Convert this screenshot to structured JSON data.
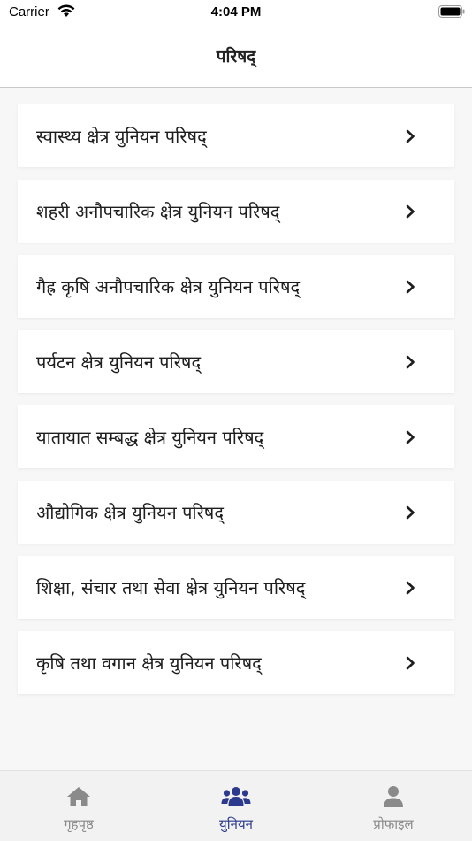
{
  "status_bar": {
    "carrier": "Carrier",
    "time": "4:04 PM"
  },
  "nav": {
    "title": "परिषद्"
  },
  "councils": [
    {
      "label": "स्वास्थ्य क्षेत्र युनियन परिषद्"
    },
    {
      "label": "शहरी अनौपचारिक क्षेत्र युनियन परिषद्"
    },
    {
      "label": "गैह्र कृषि अनौपचारिक क्षेत्र युनियन परिषद्"
    },
    {
      "label": "पर्यटन क्षेत्र युनियन परिषद्"
    },
    {
      "label": "यातायात सम्बद्ध क्षेत्र युनियन परिषद्"
    },
    {
      "label": "औद्योगिक क्षेत्र युनियन परिषद्"
    },
    {
      "label": "शिक्षा, संचार तथा सेवा क्षेत्र युनियन परिषद्"
    },
    {
      "label": "कृषि तथा वगान क्षेत्र युनियन परिषद्"
    }
  ],
  "tab_bar": {
    "tabs": [
      {
        "label": "गृहपृष्ठ",
        "icon": "home-icon",
        "active": false
      },
      {
        "label": "युनियन",
        "icon": "users-icon",
        "active": true
      },
      {
        "label": "प्रोफाइल",
        "icon": "user-icon",
        "active": false
      }
    ]
  },
  "colors": {
    "accent": "#2b3a8c",
    "inactive_tab": "#8a8a8a",
    "background": "#f7f7f7",
    "card": "#ffffff"
  }
}
